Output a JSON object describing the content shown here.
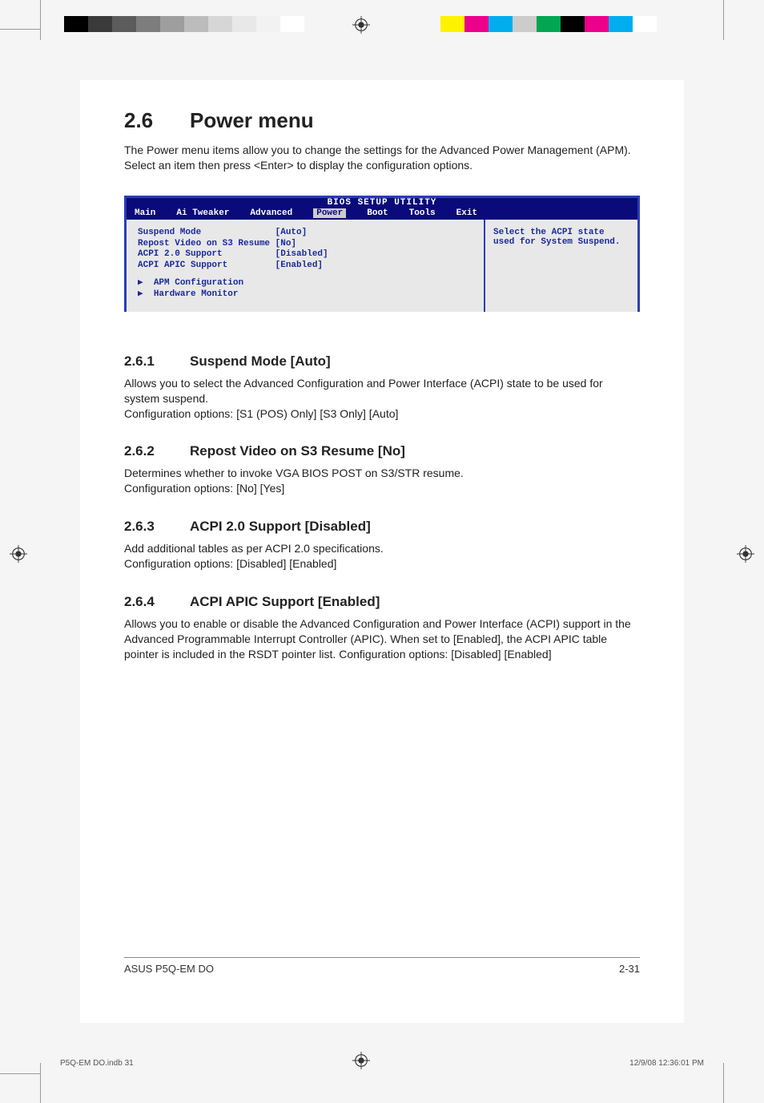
{
  "colorbars": {
    "left": [
      "#000000",
      "#3a3a3a",
      "#5c5c5c",
      "#7d7d7d",
      "#9e9e9e",
      "#bcbcbc",
      "#d6d6d6",
      "#e8e8e8",
      "#f2f2f2",
      "#ffffff"
    ],
    "right": [
      "#fff200",
      "#ec008c",
      "#00aeef",
      "#cccccc",
      "#00a651",
      "#000000",
      "#ec008c",
      "#00aeef",
      "#ffffff"
    ]
  },
  "heading": {
    "number": "2.6",
    "title": "Power menu"
  },
  "intro": "The Power menu items allow you to change the settings for the Advanced Power Management (APM). Select an item then press <Enter> to display the configuration options.",
  "bios": {
    "title": "BIOS SETUP UTILITY",
    "menu": [
      "Main",
      "Ai Tweaker",
      "Advanced",
      "Power",
      "Boot",
      "Tools",
      "Exit"
    ],
    "selected": "Power",
    "rows": [
      {
        "label": "Suspend Mode",
        "value": "[Auto]"
      },
      {
        "label": "Repost Video on S3 Resume",
        "value": "[No]"
      },
      {
        "label": "ACPI 2.0 Support",
        "value": "[Disabled]"
      },
      {
        "label": "ACPI APIC Support",
        "value": "[Enabled]"
      }
    ],
    "submenus": [
      "APM Configuration",
      "Hardware Monitor"
    ],
    "help": "Select the ACPI state used for System Suspend."
  },
  "sections": [
    {
      "num": "2.6.1",
      "title": "Suspend Mode [Auto]",
      "body": "Allows you to select the Advanced Configuration and Power Interface (ACPI) state to be used for system suspend.\nConfiguration options: [S1 (POS) Only] [S3 Only] [Auto]"
    },
    {
      "num": "2.6.2",
      "title": "Repost Video on S3 Resume [No]",
      "body": "Determines whether to invoke VGA BIOS POST on S3/STR resume.\nConfiguration options: [No] [Yes]"
    },
    {
      "num": "2.6.3",
      "title": "ACPI 2.0 Support [Disabled]",
      "body": "Add additional tables as per ACPI 2.0 specifications.\nConfiguration options: [Disabled] [Enabled]"
    },
    {
      "num": "2.6.4",
      "title": "ACPI APIC Support [Enabled]",
      "body": "Allows you to enable or disable the Advanced Configuration and Power Interface (ACPI) support in the Advanced Programmable Interrupt Controller (APIC). When set to [Enabled], the ACPI APIC table pointer is included in the RSDT pointer list. Configuration options: [Disabled] [Enabled]"
    }
  ],
  "footer": {
    "left": "ASUS P5Q-EM DO",
    "right": "2-31"
  },
  "printfooter": {
    "left": "P5Q-EM DO.indb   31",
    "right": "12/9/08   12:36:01 PM"
  }
}
